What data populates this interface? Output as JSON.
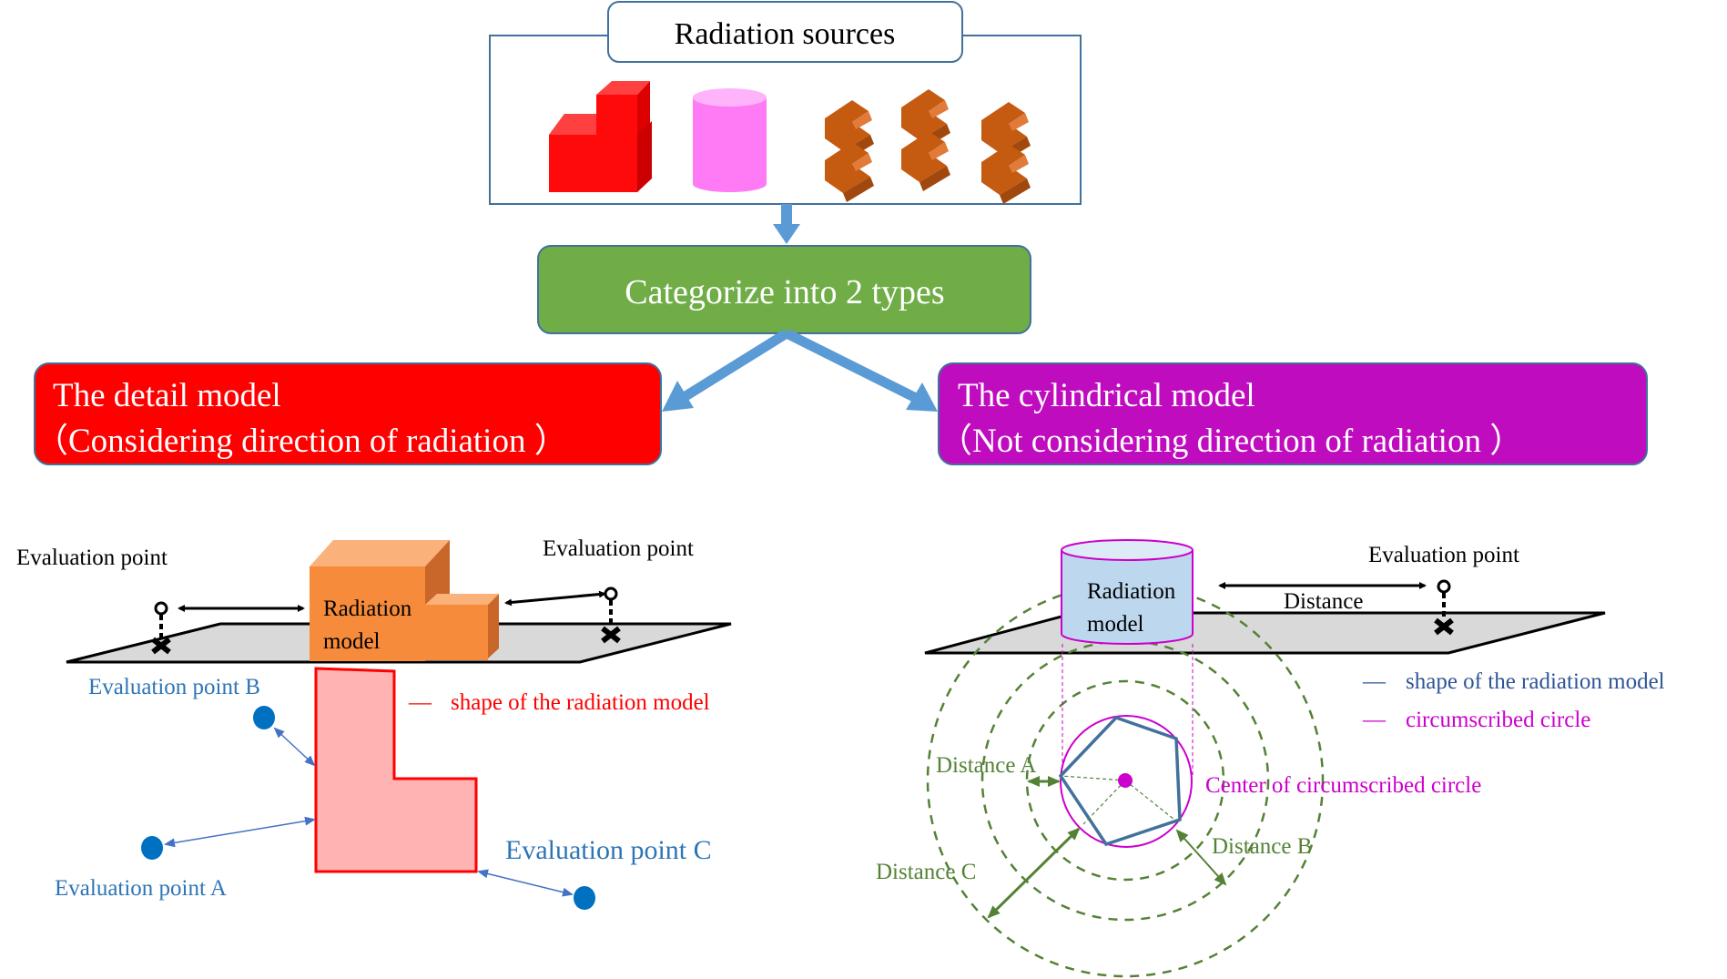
{
  "sources": {
    "title": "Radiation sources",
    "shapes": [
      "l-shaped-block",
      "cylinder",
      "zigzag-blocks",
      "zigzag-blocks",
      "zigzag-blocks"
    ]
  },
  "categorize": {
    "label": "Categorize into 2 types"
  },
  "detail_model": {
    "title": "The detail model",
    "subtitle": "（Considering direction of radiation ）",
    "color": "#ff0000"
  },
  "cylindrical_model": {
    "title": "The cylindrical model",
    "subtitle": "（Not considering direction of radiation ）",
    "color": "#c00cbf"
  },
  "left_diagram": {
    "eval_point_left": "Evaluation  point",
    "eval_point_right": "Evaluation  point",
    "model_label_line1": "Radiation",
    "model_label_line2": "model",
    "legend_mark": "—",
    "legend_label": "shape of the radiation  model",
    "point_a": "Evaluation point A",
    "point_b": "Evaluation point B",
    "point_c": "Evaluation point C"
  },
  "right_diagram": {
    "eval_point": "Evaluation  point",
    "distance": "Distance",
    "model_label_line1": "Radiation",
    "model_label_line2": "model",
    "legend_shape_mark": "—",
    "legend_shape_label": "shape of the radiation  model",
    "legend_circle_mark": "—",
    "legend_circle_label": "circumscribed  circle",
    "center_label": "Center of circumscribed  circle",
    "distance_a": "Distance  A",
    "distance_b": "Distance  B",
    "distance_c": "Distance  C"
  },
  "colors": {
    "arrow_blue": "#5b9bd5",
    "box_border": "#41719c",
    "green_box": "#70ad47",
    "orange": "#f79646",
    "eval_blue": "#2e75b6",
    "dot_blue": "#0070c0",
    "green_text": "#548235",
    "magenta": "#cc00cc",
    "pentagon": "#41719c",
    "cylinder_fill": "#bdd7ee",
    "plane": "#d9d9d9"
  }
}
